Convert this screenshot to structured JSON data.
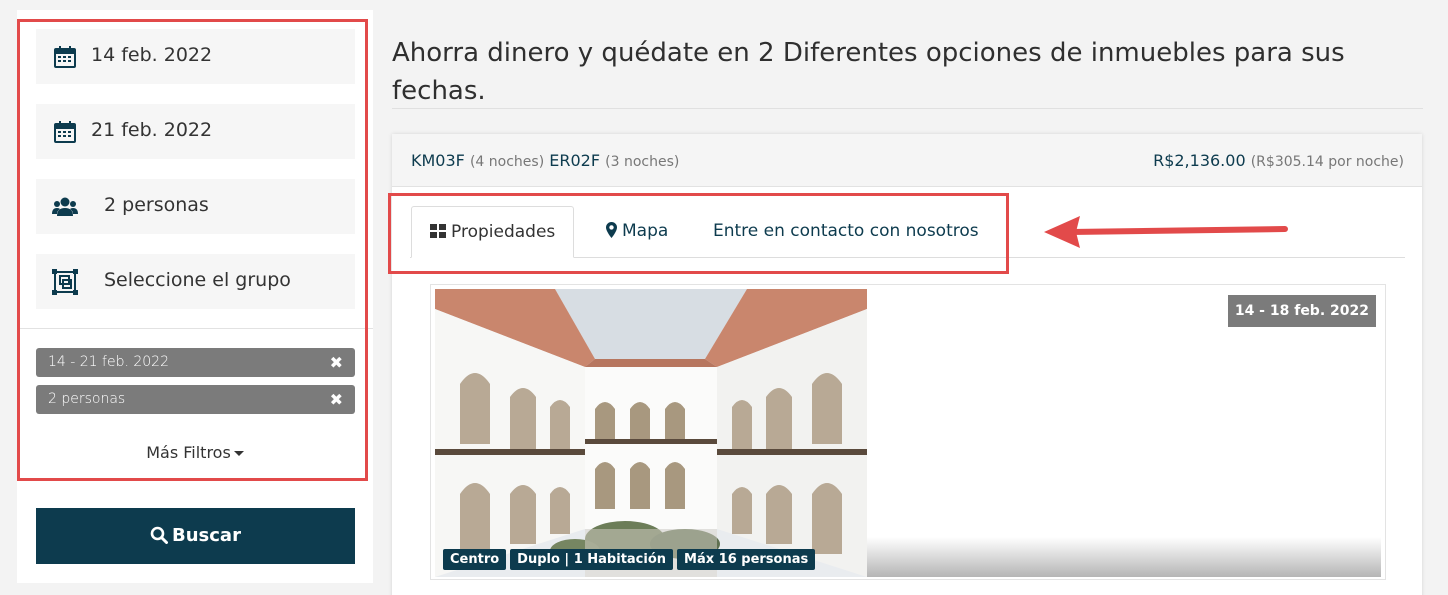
{
  "search": {
    "checkin": "14 feb. 2022",
    "checkout": "21 feb. 2022",
    "guests": "2 personas",
    "group_placeholder": "Seleccione el grupo",
    "active_filters": [
      {
        "label": "14 - 21 feb. 2022"
      },
      {
        "label": "2 personas"
      }
    ],
    "more_filters": "Más Filtros",
    "button": "Buscar"
  },
  "results": {
    "headline": "Ahorra dinero y quédate en 2 Diferentes opciones de inmuebles para sus fechas.",
    "combo": {
      "code1": "KM03F",
      "nights1": "(4 noches)",
      "code2": "ER02F",
      "nights2": "(3 noches)",
      "price": "R$2,136.00",
      "price_per_night": "(R$305.14 por noche)"
    },
    "tabs": [
      {
        "label": "Propiedades",
        "icon": "grid-icon"
      },
      {
        "label": "Mapa",
        "icon": "map-marker-icon"
      },
      {
        "label": "Entre en contacto con nosotros"
      }
    ],
    "property": {
      "dates": "14 - 18 feb. 2022",
      "tags": [
        "Centro",
        "Duplo | 1 Habitación",
        "Máx 16 personas"
      ]
    }
  },
  "colors": {
    "brand": "#0d3b4e",
    "chip": "#7b7b7b",
    "highlight": "#e24a4a"
  }
}
